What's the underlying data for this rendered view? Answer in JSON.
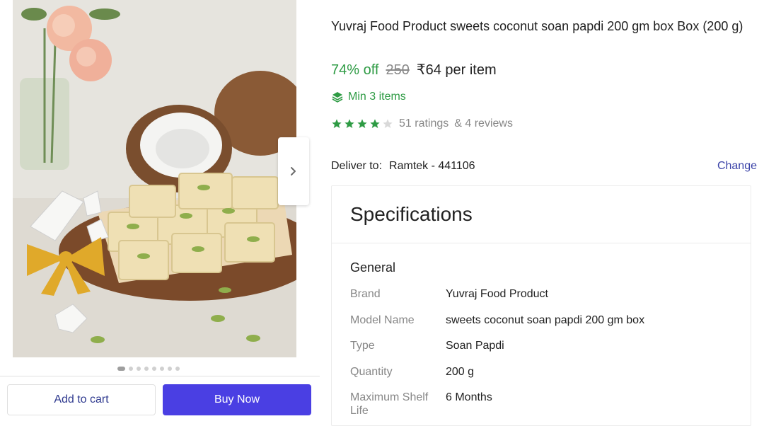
{
  "product": {
    "title": "Yuvraj Food Product sweets coconut soan papdi 200 gm box Box (200 g)",
    "discount": "74% off",
    "mrp": "250",
    "price": "₹64 per item",
    "min_items": "Min 3 items",
    "rating_stars": 4,
    "ratings_text": "51 ratings",
    "reviews_text": "& 4 reviews"
  },
  "gallery": {
    "dot_count": 8,
    "active_dot": 0
  },
  "delivery": {
    "label": "Deliver to:",
    "location": "Ramtek - 441106",
    "change_label": "Change"
  },
  "actions": {
    "add_to_cart": "Add to cart",
    "buy_now": "Buy Now"
  },
  "specifications": {
    "heading": "Specifications",
    "section": "General",
    "rows": [
      {
        "key": "Brand",
        "value": "Yuvraj Food Product"
      },
      {
        "key": "Model Name",
        "value": "sweets coconut soan papdi 200 gm box"
      },
      {
        "key": "Type",
        "value": "Soan Papdi"
      },
      {
        "key": "Quantity",
        "value": "200 g"
      },
      {
        "key": "Maximum Shelf Life",
        "value": "6 Months"
      }
    ]
  },
  "colors": {
    "accent_green": "#2e9b44",
    "buy_button": "#4a3fe3",
    "link_blue": "#3b43a8"
  },
  "icons": {
    "next": "chevron-right-icon",
    "min_items": "layers-icon",
    "star": "star-icon"
  }
}
